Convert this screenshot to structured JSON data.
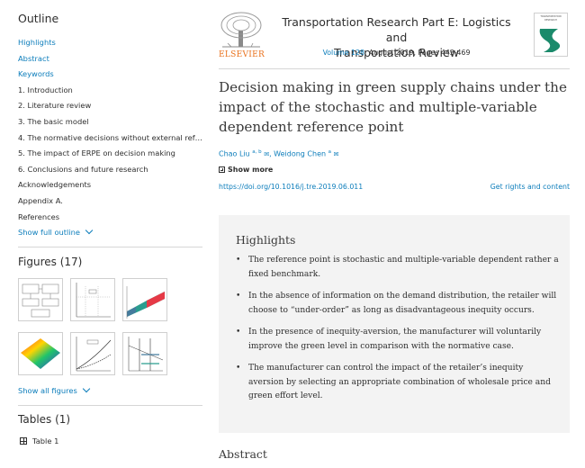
{
  "sidebar": {
    "outline_title": "Outline",
    "outline_items": [
      {
        "label": "Highlights",
        "link": true
      },
      {
        "label": "Abstract",
        "link": true
      },
      {
        "label": "Keywords",
        "link": true
      },
      {
        "label": "1. Introduction",
        "link": false
      },
      {
        "label": "2. Literature review",
        "link": false
      },
      {
        "label": "3. The basic model",
        "link": false
      },
      {
        "label": "4. The normative decisions without external reference poi…",
        "link": false
      },
      {
        "label": "5. The impact of ERPE on decision making",
        "link": false
      },
      {
        "label": "6. Conclusions and future research",
        "link": false
      },
      {
        "label": "Acknowledgements",
        "link": false
      },
      {
        "label": "Appendix A.",
        "link": false
      },
      {
        "label": "References",
        "link": false
      }
    ],
    "show_full_outline": "Show full outline",
    "figures_title": "Figures (17)",
    "show_all_figures": "Show all figures",
    "tables_title": "Tables (1)",
    "table_items": [
      "Table 1"
    ]
  },
  "header": {
    "publisher_logo_text": "ELSEVIER",
    "journal_line1": "Transportation Research Part E: Logistics and",
    "journal_line2": "Transportation Review",
    "volume_link": "Volume 128",
    "issue_rest": ", August 2019, Pages 443-469",
    "cover_text": "TRANSPORTATION RESEARCH"
  },
  "article": {
    "title": "Decision making in green supply chains under the impact of the stochastic and multiple-variable dependent reference point",
    "author1": "Chao Liu",
    "author1_sup": "a, b",
    "author2": "Weidong Chen",
    "author2_sup": "a",
    "show_more": "Show more",
    "doi": "https://doi.org/10.1016/j.tre.2019.06.011",
    "rights": "Get rights and content"
  },
  "highlights": {
    "title": "Highlights",
    "items": [
      "The reference point is stochastic and multiple-variable dependent rather a fixed benchmark.",
      "In the absence of information on the demand distribution, the retailer will choose to “under-order” as long as disadvantageous inequity occurs.",
      "In the presence of inequity-aversion, the manufacturer will voluntarily improve the green level in comparison with the normative case.",
      "The manufacturer can control the impact of the retailer’s inequity aversion by selecting an appropriate combination of wholesale price and green effort level."
    ]
  },
  "abstract_title": "Abstract",
  "colors": {
    "link": "#0c7dbb",
    "elsevier_orange": "#e9711c",
    "highlight_bg": "#f3f3f3"
  }
}
